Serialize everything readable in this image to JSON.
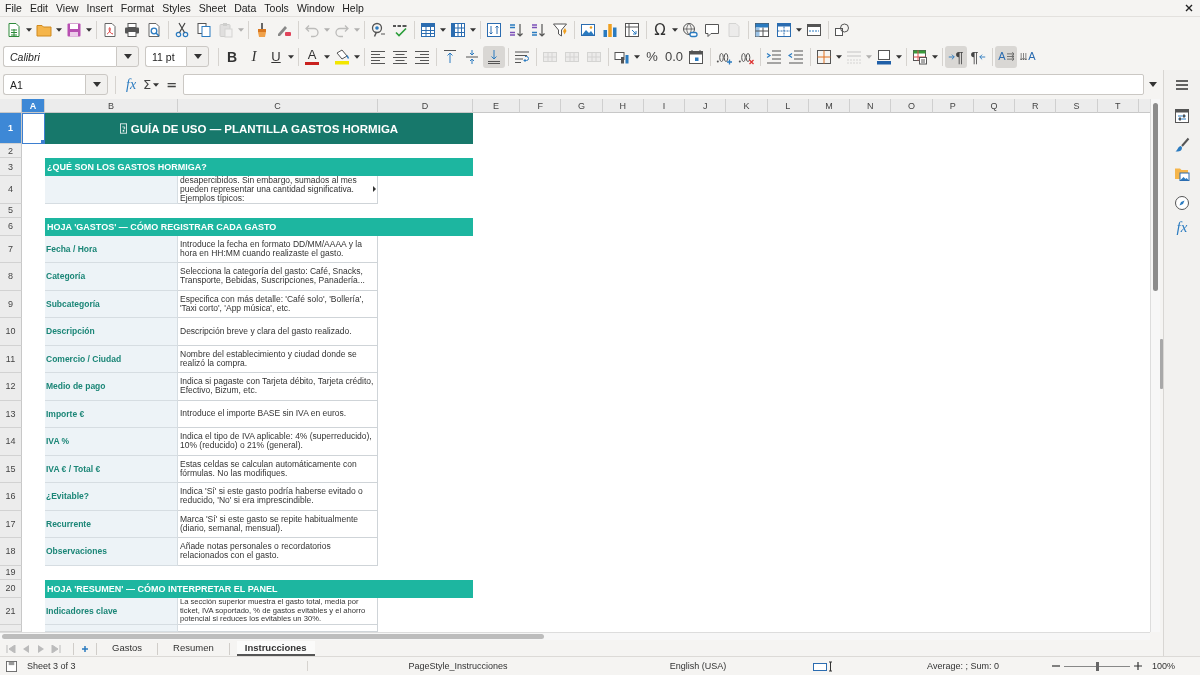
{
  "menu": [
    "File",
    "Edit",
    "View",
    "Insert",
    "Format",
    "Styles",
    "Sheet",
    "Data",
    "Tools",
    "Window",
    "Help"
  ],
  "standard_toolbar": {
    "paste": {
      "disabled": true
    },
    "undo": {
      "disabled": true
    },
    "redo": {
      "disabled": true
    },
    "special_character": "Ω",
    "header_footer": {
      "disabled": true
    }
  },
  "formatting_toolbar": {
    "font_name": "Calibri",
    "font_size": "11 pt",
    "bold": {
      "glyph": "B",
      "on": false
    },
    "italic": {
      "glyph": "I",
      "on": false
    },
    "underline": {
      "glyph": "U",
      "on": false
    },
    "font_color": "A",
    "align_left": {
      "on": false
    },
    "align_center": {
      "on": false
    },
    "align_right": {
      "on": false
    },
    "align_top": {
      "on": false
    },
    "align_middle": {
      "on": false
    },
    "align_bottom": {
      "on": true
    },
    "wrap_text": {
      "on": false
    },
    "merge_and_center": {
      "disabled": true
    },
    "merge_cells": {
      "disabled": true
    },
    "unmerge_cells": {
      "disabled": true
    },
    "percent": "%",
    "number": "0.0",
    "border_style": {
      "disabled": true
    },
    "left_to_right": {
      "glyph": "¶",
      "on": true
    },
    "right_to_left": {
      "glyph": "¶",
      "on": false
    },
    "text_left_to_right": {
      "glyph": "A",
      "on": true
    },
    "text_top_to_bottom": {
      "glyph": "A",
      "on": false
    }
  },
  "formula_bar": {
    "cell_reference": "A1",
    "function_wizard": "fx",
    "sum": "Σ",
    "formula": "="
  },
  "sidebar": {
    "functions": "fx"
  },
  "sheet": {
    "columns": [
      {
        "label": "A",
        "selected": true
      },
      {
        "label": "B",
        "selected": false
      },
      {
        "label": "C",
        "selected": false
      },
      {
        "label": "D",
        "selected": false
      },
      {
        "label": "E",
        "selected": false
      },
      {
        "label": "F",
        "selected": false
      },
      {
        "label": "G",
        "selected": false
      },
      {
        "label": "H",
        "selected": false
      },
      {
        "label": "I",
        "selected": false
      },
      {
        "label": "J",
        "selected": false
      },
      {
        "label": "K",
        "selected": false
      },
      {
        "label": "L",
        "selected": false
      },
      {
        "label": "M",
        "selected": false
      },
      {
        "label": "N",
        "selected": false
      },
      {
        "label": "O",
        "selected": false
      },
      {
        "label": "P",
        "selected": false
      },
      {
        "label": "Q",
        "selected": false
      },
      {
        "label": "R",
        "selected": false
      },
      {
        "label": "S",
        "selected": false
      },
      {
        "label": "T",
        "selected": false
      }
    ],
    "rows": [
      {
        "number": "1",
        "selected": true,
        "kind": "title",
        "text": "GUÍA DE USO — PLANTILLA GASTOS HORMIGA"
      },
      {
        "number": "2",
        "selected": false,
        "kind": "blank"
      },
      {
        "number": "3",
        "selected": false,
        "kind": "section",
        "text": "¿QUÉ SON LOS GASTOS HORMIGA?"
      },
      {
        "number": "4",
        "selected": false,
        "kind": "item",
        "description": "desapercibidos. Sin embargo, sumados al mes pueden representar una cantidad significativa. Ejemplos típicos:",
        "overflow": true
      },
      {
        "number": "5",
        "selected": false,
        "kind": "blank"
      },
      {
        "number": "6",
        "selected": false,
        "kind": "section",
        "text": "HOJA 'GASTOS' — CÓMO REGISTRAR CADA GASTO"
      },
      {
        "number": "7",
        "selected": false,
        "kind": "item",
        "label": "Fecha / Hora",
        "description": "Introduce la fecha en formato DD/MM/AAAA y la hora en HH:MM cuando realizaste el gasto."
      },
      {
        "number": "8",
        "selected": false,
        "kind": "item",
        "label": "Categoría",
        "description": "Selecciona la categoría del gasto: Café, Snacks, Transporte, Bebidas, Suscripciones, Panadería..."
      },
      {
        "number": "9",
        "selected": false,
        "kind": "item",
        "label": "Subcategoría",
        "description": "Especifica con más detalle: 'Café solo', 'Bollería', 'Taxi corto', 'App música', etc."
      },
      {
        "number": "10",
        "selected": false,
        "kind": "item",
        "label": "Descripción",
        "description": "Descripción breve y clara del gasto realizado."
      },
      {
        "number": "11",
        "selected": false,
        "kind": "item",
        "label": "Comercio / Ciudad",
        "description": "Nombre del establecimiento y ciudad donde se realizó la compra."
      },
      {
        "number": "12",
        "selected": false,
        "kind": "item",
        "label": "Medio de pago",
        "description": "Indica si pagaste con Tarjeta débito, Tarjeta crédito, Efectivo, Bizum, etc."
      },
      {
        "number": "13",
        "selected": false,
        "kind": "item",
        "label": "Importe €",
        "description": "Introduce el importe BASE sin IVA en euros."
      },
      {
        "number": "14",
        "selected": false,
        "kind": "item",
        "label": "IVA %",
        "description": "Indica el tipo de IVA aplicable: 4% (superreducido), 10% (reducido) o 21% (general)."
      },
      {
        "number": "15",
        "selected": false,
        "kind": "item",
        "label": "IVA € / Total €",
        "description": "Estas celdas se calculan automáticamente con fórmulas. No las modifiques."
      },
      {
        "number": "16",
        "selected": false,
        "kind": "item",
        "label": "¿Evitable?",
        "description": "Indica 'Sí' si este gasto podría haberse evitado o reducido, 'No' si era imprescindible."
      },
      {
        "number": "17",
        "selected": false,
        "kind": "item",
        "label": "Recurrente",
        "description": "Marca 'Sí' si este gasto se repite habitualmente (diario, semanal, mensual)."
      },
      {
        "number": "18",
        "selected": false,
        "kind": "item",
        "label": "Observaciones",
        "description": "Añade notas personales o recordatorios relacionados con el gasto."
      },
      {
        "number": "19",
        "selected": false,
        "kind": "blank"
      },
      {
        "number": "20",
        "selected": false,
        "kind": "section",
        "text": "HOJA 'RESUMEN' — CÓMO INTERPRETAR EL PANEL"
      },
      {
        "number": "21",
        "selected": false,
        "kind": "item",
        "label": "Indicadores clave",
        "description": "La sección superior muestra el gasto total, media por ticket, IVA soportado, % de gastos evitables y el ahorro potencial si reduces los evitables un 30%."
      },
      {
        "selected": false,
        "kind": "cut_off"
      }
    ]
  },
  "sheet_tabs": [
    {
      "label": "Gastos",
      "selected": false
    },
    {
      "label": "Resumen",
      "selected": false
    },
    {
      "label": "Instrucciones",
      "selected": true
    }
  ],
  "status_bar": {
    "sheet_position": "Sheet 3 of 3",
    "page_style": "PageStyle_Instrucciones",
    "language": "English (USA)",
    "selection_summary": "Average: ; Sum: 0",
    "zoom": "100%",
    "zoom_slider": {
      "level": 0.5
    }
  }
}
